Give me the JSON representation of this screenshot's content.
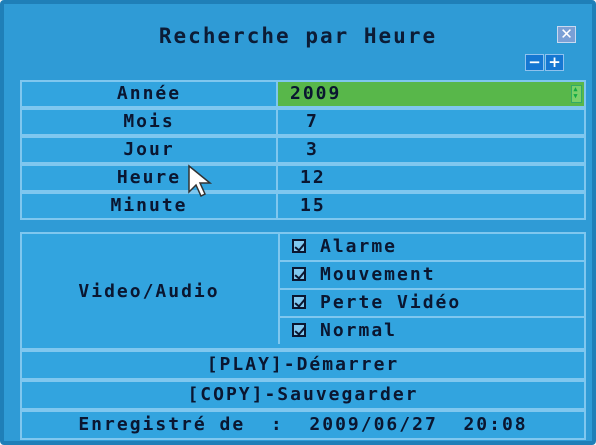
{
  "window": {
    "title": "Recherche par Heure",
    "close_icon": "close-icon",
    "minus_label": "−",
    "plus_label": "+"
  },
  "fields": {
    "year": {
      "label": "Année",
      "value": "2009"
    },
    "month": {
      "label": "Mois",
      "value": "7"
    },
    "day": {
      "label": "Jour",
      "value": "3"
    },
    "hour": {
      "label": "Heure",
      "value": "12"
    },
    "minute": {
      "label": "Minute",
      "value": "15"
    }
  },
  "video_audio": {
    "label": "Video/Audio",
    "options": [
      {
        "label": "Alarme",
        "checked": true
      },
      {
        "label": "Mouvement",
        "checked": true
      },
      {
        "label": "Perte Vidéo",
        "checked": true
      },
      {
        "label": "Normal",
        "checked": true
      }
    ]
  },
  "actions": {
    "play": "[PLAY]-Démarrer",
    "copy": "[COPY]-Sauvegarder"
  },
  "footer": {
    "recorded": "Enregistré de  :  2009/06/27  20:08"
  },
  "colors": {
    "panel": "#2f9bd6",
    "row": "#32a4df",
    "border": "#7fc7ef",
    "selected": "#58b74a",
    "text": "#0a1630"
  }
}
